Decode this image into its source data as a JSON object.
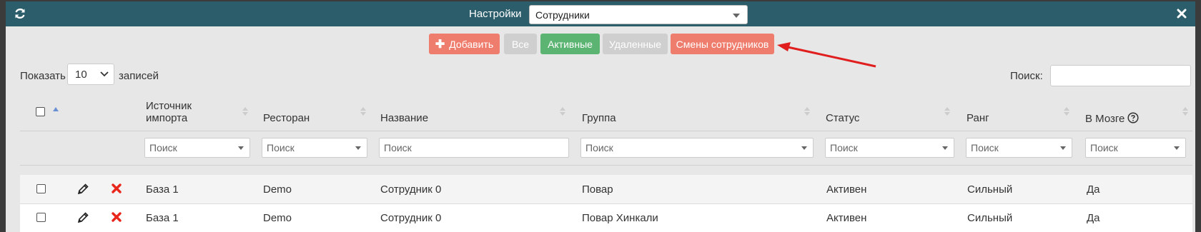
{
  "header": {
    "title": "Настройки",
    "select_value": "Сотрудники",
    "refresh_icon": "refresh-icon",
    "close_icon": "close-icon",
    "bg_color": "#2b5d6b"
  },
  "toolbar": {
    "add_label": "Добавить",
    "all_label": "Все",
    "active_label": "Активные",
    "deleted_label": "Удаленные",
    "shifts_label": "Смены сотрудников",
    "colors": {
      "add": "#ef7d6d",
      "active": "#5cb473",
      "disabled": "#cfcfcf",
      "annotation_arrow": "#e01e1e"
    }
  },
  "length": {
    "prefix": "Показать",
    "value": "10",
    "suffix": "записей"
  },
  "search": {
    "label": "Поиск:",
    "value": ""
  },
  "table": {
    "columns": [
      "Источник импорта",
      "Ресторан",
      "Название",
      "Группа",
      "Статус",
      "Ранг",
      "В Мозге"
    ],
    "filter_placeholder": "Поиск",
    "rows": [
      {
        "source": "База 1",
        "restaurant": "Demo",
        "name": "Сотрудник 0",
        "group": "Повар",
        "status": "Активен",
        "rank": "Сильный",
        "in_brain": "Да"
      },
      {
        "source": "База 1",
        "restaurant": "Demo",
        "name": "Сотрудник 0",
        "group": "Повар Хинкали",
        "status": "Активен",
        "rank": "Сильный",
        "in_brain": "Да"
      }
    ]
  }
}
